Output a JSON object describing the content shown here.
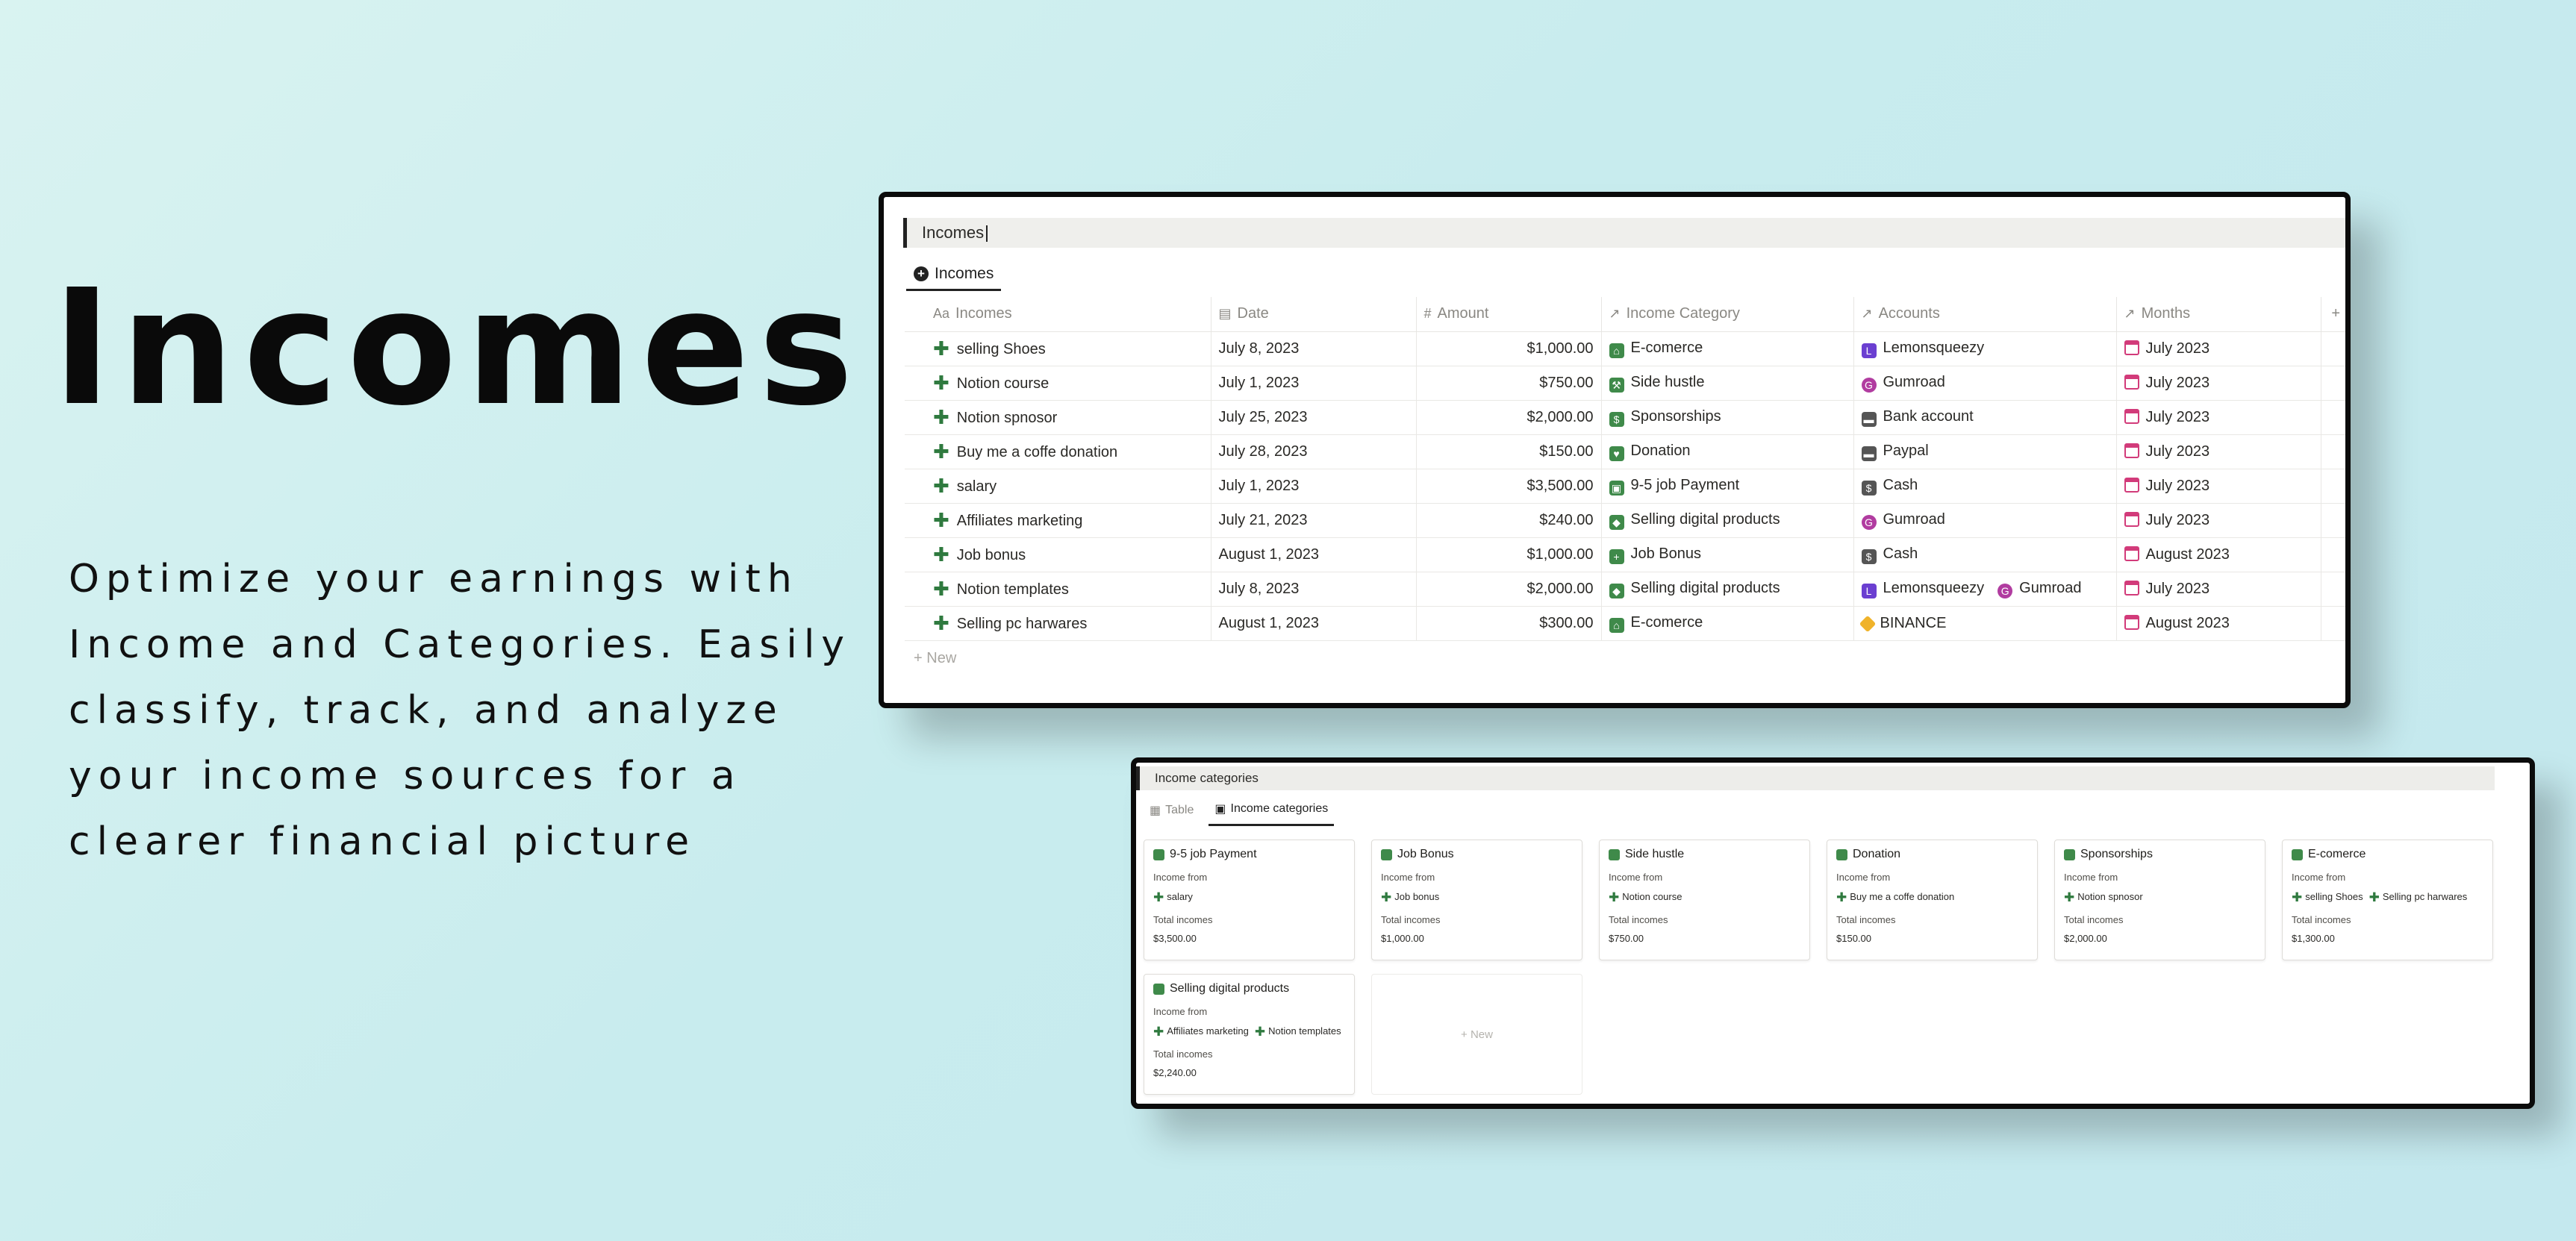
{
  "hero": {
    "title": "Incomes",
    "description": "Optimize your earnings with Income and Categories. Easily classify, track, and analyze your income sources for a clearer financial picture"
  },
  "incomes_window": {
    "title": "Incomes",
    "tab": "Incomes",
    "columns": [
      "Incomes",
      "Date",
      "Amount",
      "Income Category",
      "Accounts",
      "Months"
    ],
    "rows": [
      {
        "name": "selling Shoes",
        "date": "July 8, 2023",
        "amount": "$1,000.00",
        "category": "E-comerce",
        "account": "Lemonsqueezy",
        "account2": "",
        "month": "July 2023"
      },
      {
        "name": "Notion course",
        "date": "July 1, 2023",
        "amount": "$750.00",
        "category": "Side hustle",
        "account": "Gumroad",
        "account2": "",
        "month": "July 2023"
      },
      {
        "name": "Notion spnosor",
        "date": "July 25, 2023",
        "amount": "$2,000.00",
        "category": "Sponsorships",
        "account": "Bank account",
        "account2": "",
        "month": "July 2023"
      },
      {
        "name": "Buy me a coffe donation",
        "date": "July 28, 2023",
        "amount": "$150.00",
        "category": "Donation",
        "account": "Paypal",
        "account2": "",
        "month": "July 2023"
      },
      {
        "name": "salary",
        "date": "July 1, 2023",
        "amount": "$3,500.00",
        "category": "9-5 job Payment",
        "account": "Cash",
        "account2": "",
        "month": "July 2023"
      },
      {
        "name": "Affiliates marketing",
        "date": "July 21, 2023",
        "amount": "$240.00",
        "category": "Selling digital products",
        "account": "Gumroad",
        "account2": "",
        "month": "July 2023"
      },
      {
        "name": "Job bonus",
        "date": "August 1, 2023",
        "amount": "$1,000.00",
        "category": "Job Bonus",
        "account": "Cash",
        "account2": "",
        "month": "August 2023"
      },
      {
        "name": "Notion templates",
        "date": "July 8, 2023",
        "amount": "$2,000.00",
        "category": "Selling digital products",
        "account": "Lemonsqueezy",
        "account2": "Gumroad",
        "month": "July 2023"
      },
      {
        "name": "Selling pc harwares",
        "date": "August 1, 2023",
        "amount": "$300.00",
        "category": "E-comerce",
        "account": "BINANCE",
        "account2": "",
        "month": "August 2023"
      }
    ],
    "new_label": "New",
    "add_column_label": "+"
  },
  "categories_window": {
    "title": "Income categories",
    "tabs": [
      "Table",
      "Income categories"
    ],
    "income_from_label": "Income from",
    "total_label": "Total incomes",
    "new_label": "New",
    "cards": [
      {
        "title": "9-5 job Payment",
        "items": [
          "salary"
        ],
        "total": "$3,500.00"
      },
      {
        "title": "Job Bonus",
        "items": [
          "Job bonus"
        ],
        "total": "$1,000.00"
      },
      {
        "title": "Side hustle",
        "items": [
          "Notion course"
        ],
        "total": "$750.00"
      },
      {
        "title": "Donation",
        "items": [
          "Buy me a coffe donation"
        ],
        "total": "$150.00"
      },
      {
        "title": "Sponsorships",
        "items": [
          "Notion spnosor"
        ],
        "total": "$2,000.00"
      },
      {
        "title": "E-comerce",
        "items": [
          "selling Shoes",
          "Selling pc harwares"
        ],
        "total": "$1,300.00"
      },
      {
        "title": "Selling digital products",
        "items": [
          "Affiliates marketing",
          "Notion templates"
        ],
        "total": "$2,240.00"
      }
    ]
  },
  "colors": {
    "accent_green": "#2f7a3f",
    "calendar_pink": "#d23b7a"
  }
}
